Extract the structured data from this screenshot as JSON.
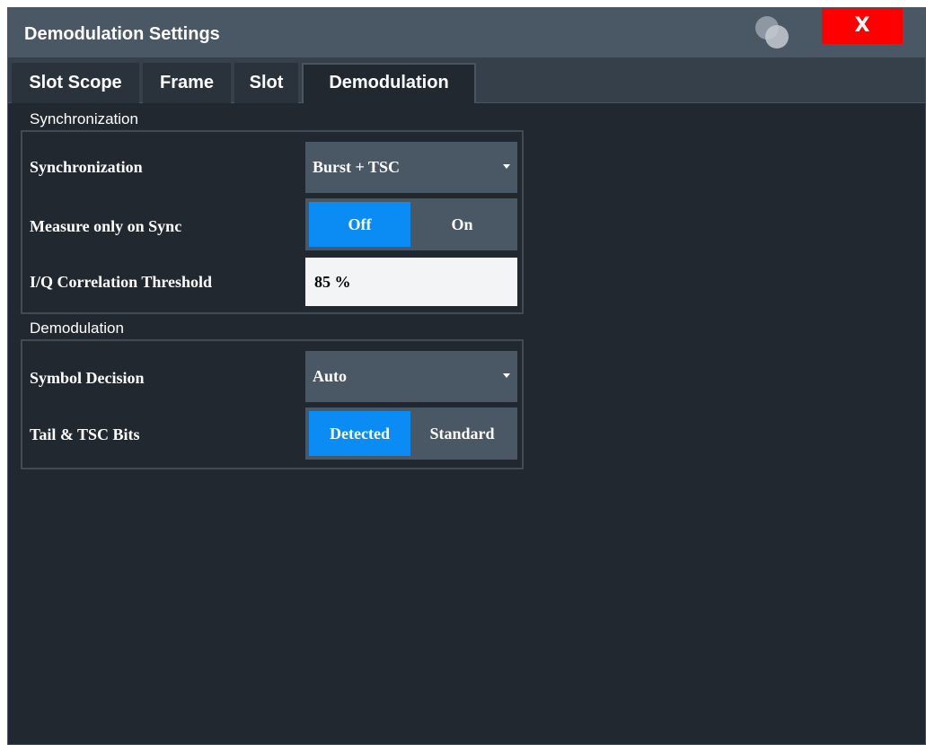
{
  "window": {
    "title": "Demodulation Settings",
    "close_label": "X"
  },
  "tabs": [
    {
      "label": "Slot Scope",
      "active": false
    },
    {
      "label": "Frame",
      "active": false
    },
    {
      "label": "Slot",
      "active": false
    },
    {
      "label": "Demodulation",
      "active": true
    }
  ],
  "sync_section": {
    "label": "Synchronization",
    "synchronization": {
      "label": "Synchronization",
      "value": "Burst + TSC"
    },
    "measure_only_on_sync": {
      "label": "Measure only on Sync",
      "options": [
        "Off",
        "On"
      ],
      "selected": "Off"
    },
    "iq_threshold": {
      "label": "I/Q Correlation Threshold",
      "value": "85 %"
    }
  },
  "demod_section": {
    "label": "Demodulation",
    "symbol_decision": {
      "label": "Symbol Decision",
      "value": "Auto"
    },
    "tail_tsc_bits": {
      "label": "Tail & TSC Bits",
      "options": [
        "Detected",
        "Standard"
      ],
      "selected": "Detected"
    }
  },
  "colors": {
    "titlebar": "#4a5865",
    "background": "#22282f",
    "accent": "#0a8cf4",
    "close": "#ff0000"
  }
}
